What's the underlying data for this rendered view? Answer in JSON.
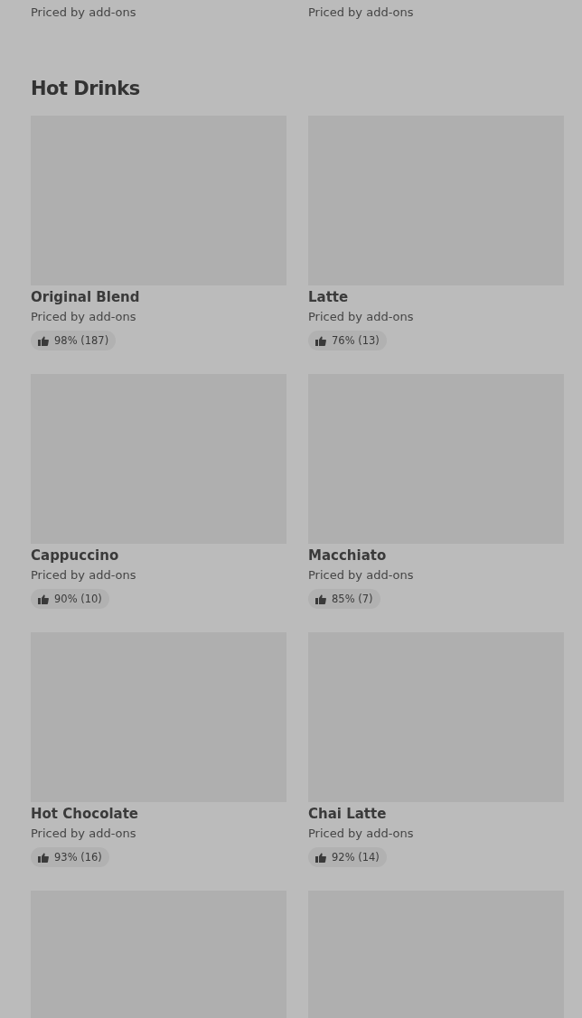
{
  "previous_section": {
    "items": [
      {
        "price": "Priced by add-ons"
      },
      {
        "price": "Priced by add-ons"
      }
    ]
  },
  "section": {
    "title": "Hot Drinks",
    "items": [
      {
        "kind": "full",
        "name": "Original Blend",
        "price": "Priced by add-ons",
        "rating": "98% (187)"
      },
      {
        "kind": "full",
        "name": "Latte",
        "price": "Priced by add-ons",
        "rating": "76% (13)"
      },
      {
        "kind": "full",
        "name": "Cappuccino",
        "price": "Priced by add-ons",
        "rating": "90% (10)"
      },
      {
        "kind": "full",
        "name": "Macchiato",
        "price": "Priced by add-ons",
        "rating": "85% (7)"
      },
      {
        "kind": "full",
        "name": "Hot Chocolate",
        "price": "Priced by add-ons",
        "rating": "93% (16)"
      },
      {
        "kind": "full",
        "name": "Chai Latte",
        "price": "Priced by add-ons",
        "rating": "92% (14)"
      },
      {
        "kind": "image_only"
      },
      {
        "kind": "image_only"
      }
    ]
  }
}
